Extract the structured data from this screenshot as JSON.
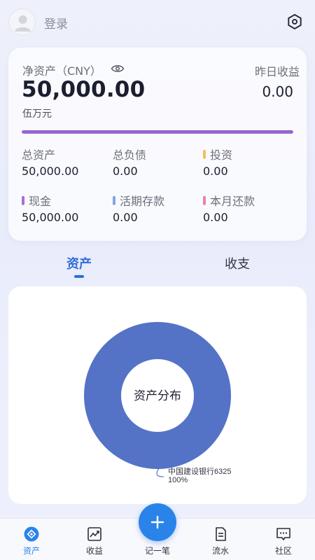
{
  "header": {
    "login_label": "登录"
  },
  "summary": {
    "net_worth_label": "净资产（CNY）",
    "net_worth_value": "50,000.00",
    "net_worth_words": "伍万元",
    "yesterday_label": "昨日收益",
    "yesterday_value": "0.00",
    "progress_fraction": 1.0,
    "progress_color": "#9567cf",
    "stats": [
      {
        "label": "总资产",
        "value": "50,000.00",
        "dot": null
      },
      {
        "label": "总负债",
        "value": "0.00",
        "dot": null
      },
      {
        "label": "投资",
        "value": "0.00",
        "dot": "#f2c15b"
      },
      {
        "label": "现金",
        "value": "50,000.00",
        "dot": "#a86fd4"
      },
      {
        "label": "活期存款",
        "value": "0.00",
        "dot": "#7fa6e6"
      },
      {
        "label": "本月还款",
        "value": "0.00",
        "dot": "#ec7fb1"
      }
    ]
  },
  "tabs": [
    {
      "label": "资产",
      "active": true
    },
    {
      "label": "收支",
      "active": false
    }
  ],
  "chart_data": {
    "type": "pie",
    "center_label": "资产分布",
    "slices": [
      {
        "name": "中国建设银行6325",
        "value": 50000,
        "percent_label": "100%",
        "color": "#5473c6"
      }
    ]
  },
  "bottom_nav": [
    {
      "label": "资产",
      "icon": "assets-icon",
      "active": true
    },
    {
      "label": "收益",
      "icon": "trend-chart-icon",
      "active": false
    },
    {
      "label": "记一笔",
      "icon": "plus-icon",
      "active": false
    },
    {
      "label": "流水",
      "icon": "document-icon",
      "active": false
    },
    {
      "label": "社区",
      "icon": "chat-bubble-icon",
      "active": false
    }
  ],
  "colors": {
    "accent": "#2a83e8",
    "tab_active": "#2f6fd6"
  }
}
